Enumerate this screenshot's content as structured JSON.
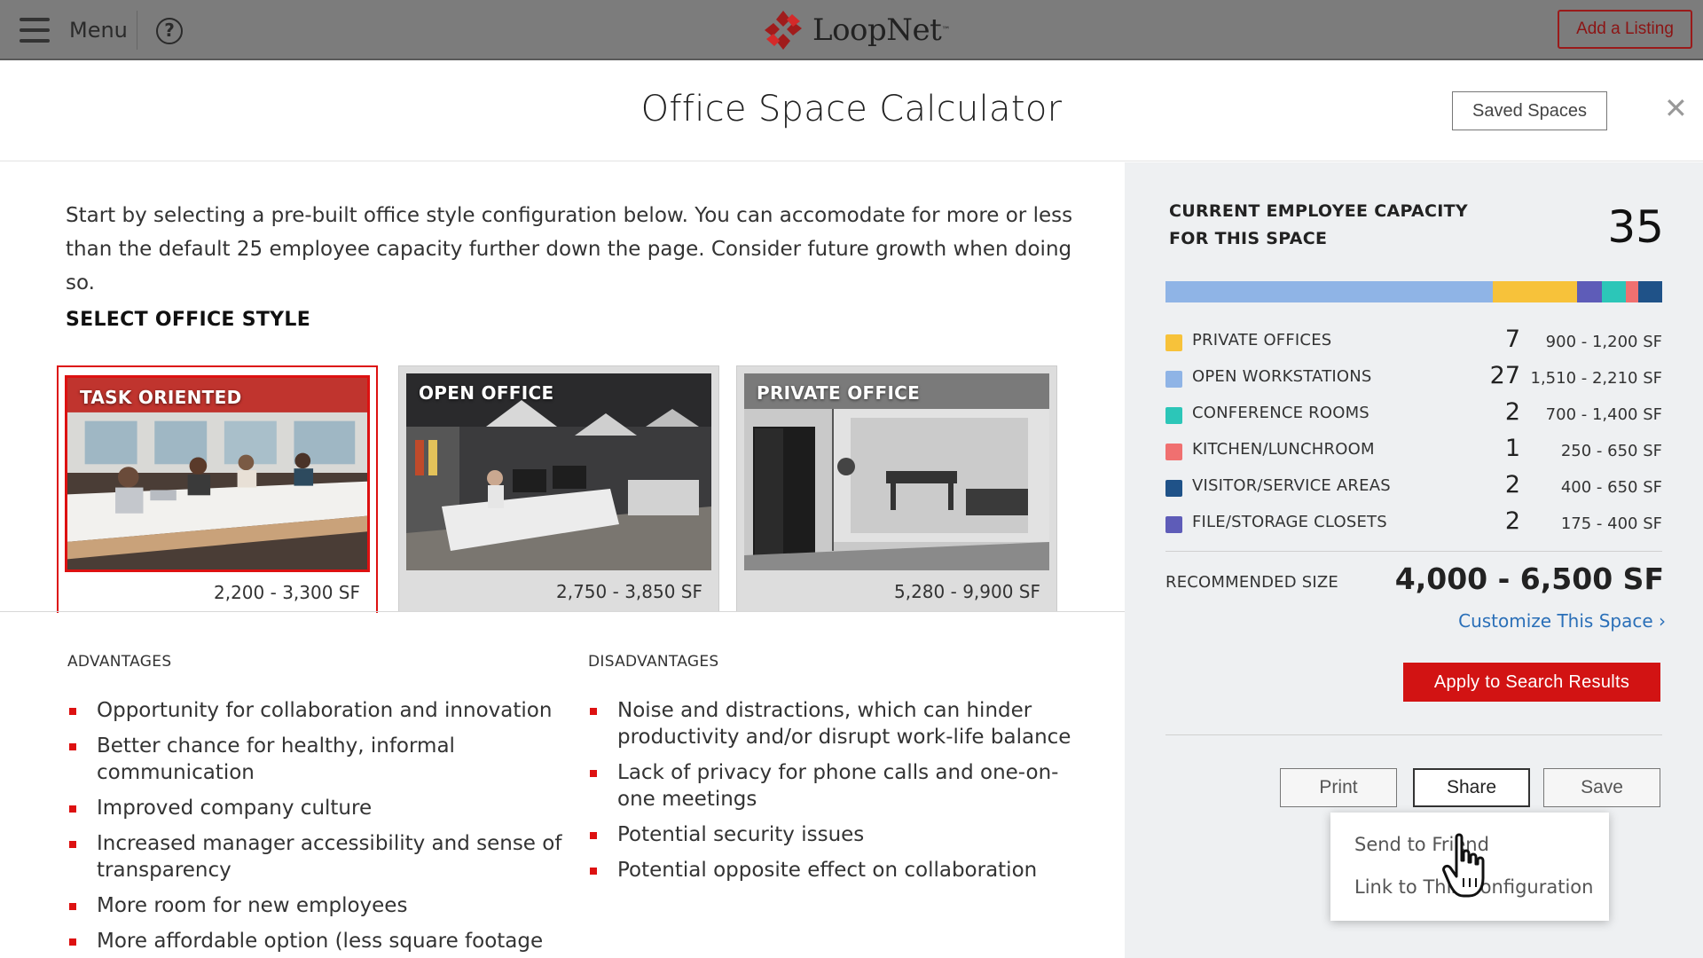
{
  "nav": {
    "menu_label": "Menu",
    "help_glyph": "?",
    "logo_text": "LoopNet",
    "logo_tm": "™",
    "add_listing_label": "Add a Listing"
  },
  "modal": {
    "title": "Office Space Calculator",
    "saved_spaces_label": "Saved Spaces",
    "close_glyph": "✕"
  },
  "intro_text": "Start by selecting a pre-built office style configuration below. You can accomodate for more or less than the default 25 employee capacity further down the page. Consider future growth when doing so.",
  "select_style_title": "SELECT OFFICE STYLE",
  "office_styles": [
    {
      "label": "TASK ORIENTED",
      "sf": "2,200 - 3,300 SF",
      "selected": true
    },
    {
      "label": "OPEN OFFICE",
      "sf": "2,750 - 3,850 SF",
      "selected": false
    },
    {
      "label": "PRIVATE OFFICE",
      "sf": "5,280 - 9,900 SF",
      "selected": false
    }
  ],
  "advantages": {
    "title": "ADVANTAGES",
    "items": [
      "Opportunity for collaboration and innovation",
      "Better chance for healthy, informal communication",
      "Improved company culture",
      "Increased manager accessibility and sense of transparency",
      "More room for new employees",
      "More affordable option (less square footage"
    ]
  },
  "disadvantages": {
    "title": "DISADVANTAGES",
    "items": [
      "Noise and distractions, which can hinder productivity and/or disrupt work-life balance",
      "Lack of privacy for phone calls and one-on-one meetings",
      "Potential security issues",
      "Potential opposite effect on collaboration"
    ]
  },
  "capacity": {
    "label": "CURRENT EMPLOYEE CAPACITY FOR THIS SPACE",
    "value": "35"
  },
  "capacity_breakdown": [
    {
      "name": "PRIVATE OFFICES",
      "count": "7",
      "sf": "900 - 1,200 SF",
      "color": "#f7c23a"
    },
    {
      "name": "OPEN WORKSTATIONS",
      "count": "27",
      "sf": "1,510 - 2,210 SF",
      "color": "#8fb4e6"
    },
    {
      "name": "CONFERENCE ROOMS",
      "count": "2",
      "sf": "700 - 1,400 SF",
      "color": "#2cc6b8"
    },
    {
      "name": "KITCHEN/LUNCHROOM",
      "count": "1",
      "sf": "250 - 650 SF",
      "color": "#f07070"
    },
    {
      "name": "VISITOR/SERVICE AREAS",
      "count": "2",
      "sf": "400 - 650 SF",
      "color": "#1f5288"
    },
    {
      "name": "FILE/STORAGE CLOSETS",
      "count": "2",
      "sf": "175 - 400 SF",
      "color": "#5e5cb8"
    }
  ],
  "capacity_bar_order": [
    "OPEN WORKSTATIONS",
    "PRIVATE OFFICES",
    "FILE/STORAGE CLOSETS",
    "CONFERENCE ROOMS",
    "KITCHEN/LUNCHROOM",
    "VISITOR/SERVICE AREAS"
  ],
  "recommended": {
    "label": "RECOMMENDED SIZE",
    "value": "4,000 - 6,500 SF"
  },
  "customize_label": "Customize This Space ›",
  "apply_label": "Apply to Search Results",
  "actions": {
    "print": "Print",
    "share": "Share",
    "save": "Save"
  },
  "share_menu": {
    "send_to_friend": "Send to Friend",
    "link_to_configuration": "Link to This Configuration"
  },
  "colors": {
    "accent_red": "#d21313",
    "link_blue": "#2a6fb8",
    "nav_gray": "#7c7c7c"
  }
}
